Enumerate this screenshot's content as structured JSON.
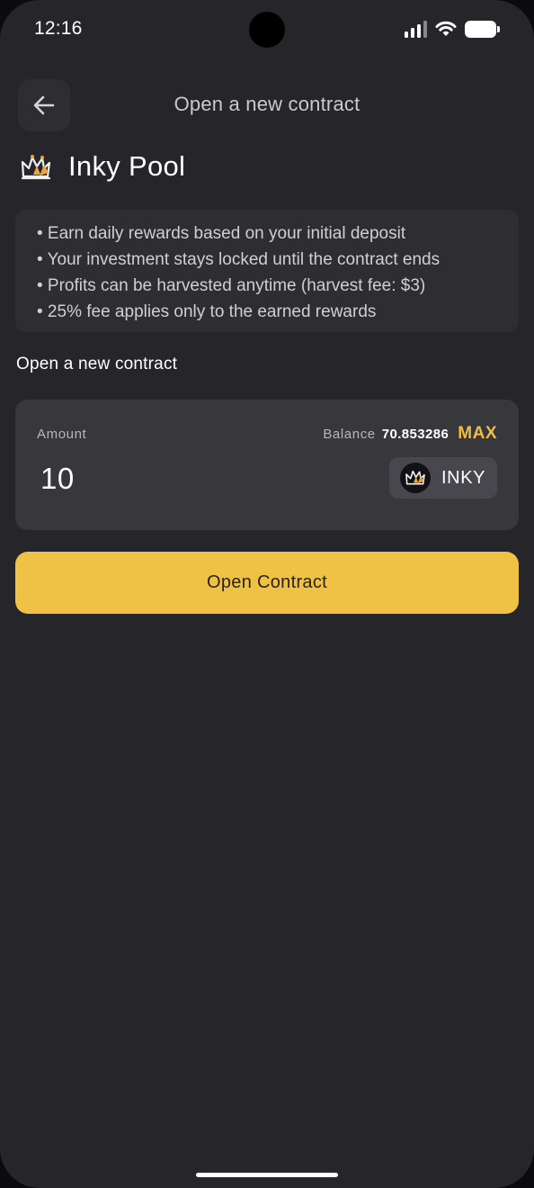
{
  "status_bar": {
    "time": "12:16"
  },
  "header": {
    "title": "Open a new contract",
    "back_icon": "arrow-left-icon"
  },
  "pool": {
    "name": "Inky Pool",
    "logo_icon": "crown-icon"
  },
  "info": {
    "lines": [
      "• Earn daily rewards based on your initial deposit",
      "• Your investment stays locked until the contract ends",
      "• Profits can be harvested anytime (harvest fee: $3)",
      "• 25% fee applies only to the earned rewards"
    ]
  },
  "form": {
    "section_title": "Open a new contract",
    "amount_label": "Amount",
    "balance_label": "Balance",
    "balance_value": "70.853286",
    "max_label": "MAX",
    "amount_value": "10",
    "token": {
      "label": "INKY",
      "icon": "crown-icon"
    },
    "submit_label": "Open Contract"
  },
  "colors": {
    "background": "#262529",
    "card": "#2e2d32",
    "input_card": "#38373c",
    "accent": "#efc246",
    "text": "#ffffff",
    "muted": "#b6b6bc"
  }
}
